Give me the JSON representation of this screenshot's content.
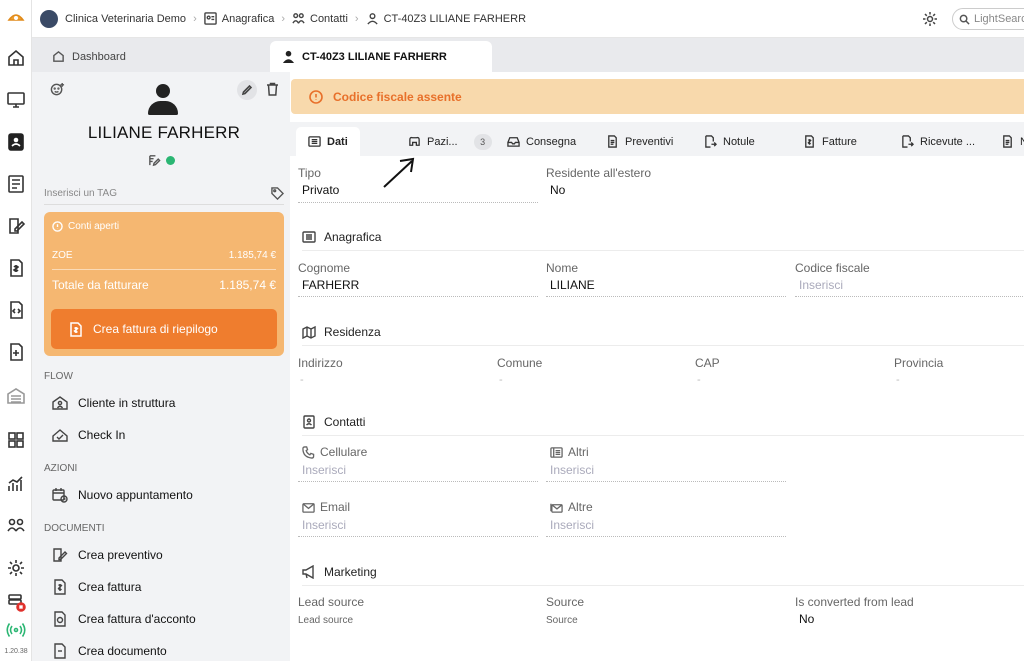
{
  "app": {
    "practice_name": "Clinica Veterinaria Demo",
    "version": "1.20.38"
  },
  "breadcrumb": [
    {
      "label": "Anagrafica",
      "icon": "person-card-icon"
    },
    {
      "label": "Contatti",
      "icon": "people-icon"
    },
    {
      "label": "CT-40Z3 LILIANE FARHERR",
      "icon": "person-icon"
    }
  ],
  "search": {
    "placeholder": "LightSearch"
  },
  "window_tabs": [
    {
      "label": "Dashboard",
      "icon": "home-icon"
    },
    {
      "label": "CT-40Z3 LILIANE FARHERR",
      "icon": "person-icon"
    }
  ],
  "profile": {
    "name": "LILIANE FARHERR",
    "tag_placeholder": "Inserisci un TAG",
    "status_color": "#2bb673"
  },
  "open_accounts": {
    "title": "Conti aperti",
    "row_label": "ZOE",
    "row_value": "1.185,74 €",
    "total_label": "Totale da fatturare",
    "total_value": "1.185,74 €",
    "button": "Crea fattura di riepilogo",
    "color": "#f5b771",
    "button_color": "#ef7d2e"
  },
  "sections": {
    "flow": "FLOW",
    "actions": "AZIONI",
    "documents": "DOCUMENTI"
  },
  "flow_items": [
    "Cliente in struttura",
    "Check In"
  ],
  "action_items": [
    "Nuovo appuntamento"
  ],
  "document_items": [
    "Crea preventivo",
    "Crea fattura",
    "Crea fattura d'acconto",
    "Crea documento"
  ],
  "alert": {
    "text": "Codice fiscale assente",
    "color": "#e8702a"
  },
  "content_tabs": [
    {
      "label": "Dati",
      "icon": "list-icon"
    },
    {
      "label": "Pazi...",
      "icon": "pet-icon",
      "badge": "3"
    },
    {
      "label": "Consegna",
      "icon": "inbox-icon"
    },
    {
      "label": "Preventivi",
      "icon": "doc-icon"
    },
    {
      "label": "Notule",
      "icon": "doc-arrow-icon"
    },
    {
      "label": "Fatture",
      "icon": "invoice-icon"
    },
    {
      "label": "Ricevute ...",
      "icon": "receipt-icon"
    },
    {
      "label": "N",
      "icon": "doc-icon"
    }
  ],
  "form": {
    "tipo_label": "Tipo",
    "tipo_value": "Privato",
    "residente_label": "Residente all'estero",
    "residente_value": "No",
    "anagrafica_title": "Anagrafica",
    "cognome_label": "Cognome",
    "cognome_value": "FARHERR",
    "nome_label": "Nome",
    "nome_value": "LILIANE",
    "cf_label": "Codice fiscale",
    "cf_placeholder": "Inserisci",
    "residenza_title": "Residenza",
    "indirizzo_label": "Indirizzo",
    "comune_label": "Comune",
    "cap_label": "CAP",
    "provincia_label": "Provincia",
    "empty": "-",
    "contatti_title": "Contatti",
    "cellulare_label": "Cellulare",
    "altri_label": "Altri",
    "email_label": "Email",
    "altre_label": "Altre",
    "input_placeholder": "Inserisci",
    "marketing_title": "Marketing",
    "lead_source_label": "Lead source",
    "lead_source_value": "Lead source",
    "source_label": "Source",
    "source_value": "Source",
    "converted_label": "Is converted from lead",
    "converted_value": "No"
  }
}
